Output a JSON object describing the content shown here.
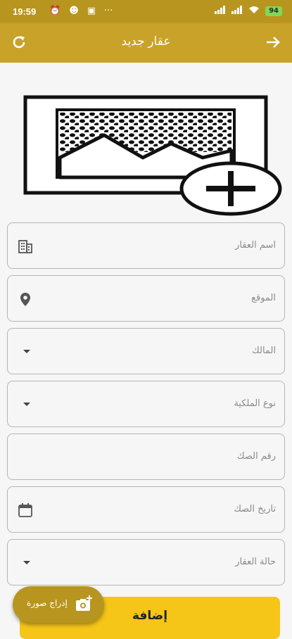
{
  "status_bar": {
    "time": "19:59",
    "battery": "94"
  },
  "app_bar": {
    "title": "عقار جديد"
  },
  "form": {
    "fields": [
      {
        "label": "اسم العقار",
        "icon": "building-icon"
      },
      {
        "label": "الموقع",
        "icon": "location-pin-icon"
      },
      {
        "label": "المالك",
        "icon": "dropdown-caret-icon"
      },
      {
        "label": "نوع الملكية",
        "icon": "dropdown-caret-icon"
      },
      {
        "label": "رقم الصك",
        "icon": ""
      },
      {
        "label": "تاريخ الصك",
        "icon": "calendar-icon"
      },
      {
        "label": "حالة العقار",
        "icon": "dropdown-caret-icon"
      }
    ],
    "submit_label": "إضافة"
  },
  "fab": {
    "label": "إدراج صورة",
    "icon": "add-photo-icon"
  },
  "colors": {
    "status_bar": "#b8951e",
    "app_bar": "#c9a22a",
    "submit_button": "#f5c518",
    "fab": "#b8951e"
  }
}
